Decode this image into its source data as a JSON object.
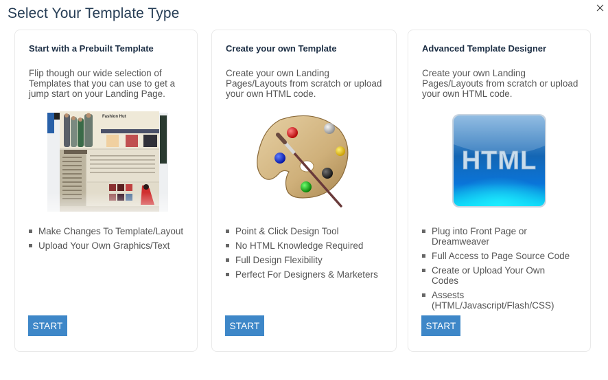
{
  "modal": {
    "title": "Select Your Template Type",
    "close_icon": "close-x-icon"
  },
  "cards": [
    {
      "title": "Start with a Prebuilt Template",
      "description": "Flip though our wide selection of Templates that you can use to get a jump start on your Landing Page.",
      "image": "prebuilt-template-preview-thumbnail",
      "image_title_text": "Fashion Hut",
      "features": [
        "Make Changes To Template/Layout",
        "Upload Your Own Graphics/Text"
      ],
      "button_label": "START"
    },
    {
      "title": "Create your own Template",
      "description": "Create your own Landing Pages/Layouts from scratch or upload your own HTML code.",
      "image": "paint-palette-icon",
      "features": [
        "Point & Click Design Tool",
        "No HTML Knowledge Required",
        "Full Design Flexibility",
        "Perfect For Designers & Marketers"
      ],
      "button_label": "START"
    },
    {
      "title": "Advanced Template Designer",
      "description": "Create your own Landing Pages/Layouts from scratch or upload your own HTML code.",
      "image": "html-icon",
      "image_text": "HTML",
      "features": [
        "Plug into Front Page or Dreamweaver",
        "Full Access to Page Source Code",
        "Create or Upload Your Own Codes",
        "Assests (HTML/Javascript/Flash/CSS)"
      ],
      "button_label": "START"
    }
  ],
  "colors": {
    "title": "#263d55",
    "card_title": "#1d2f45",
    "body_text": "#555555",
    "button_bg": "#3e87c8",
    "button_text": "#ffffff",
    "card_border": "#e9e9e9"
  }
}
